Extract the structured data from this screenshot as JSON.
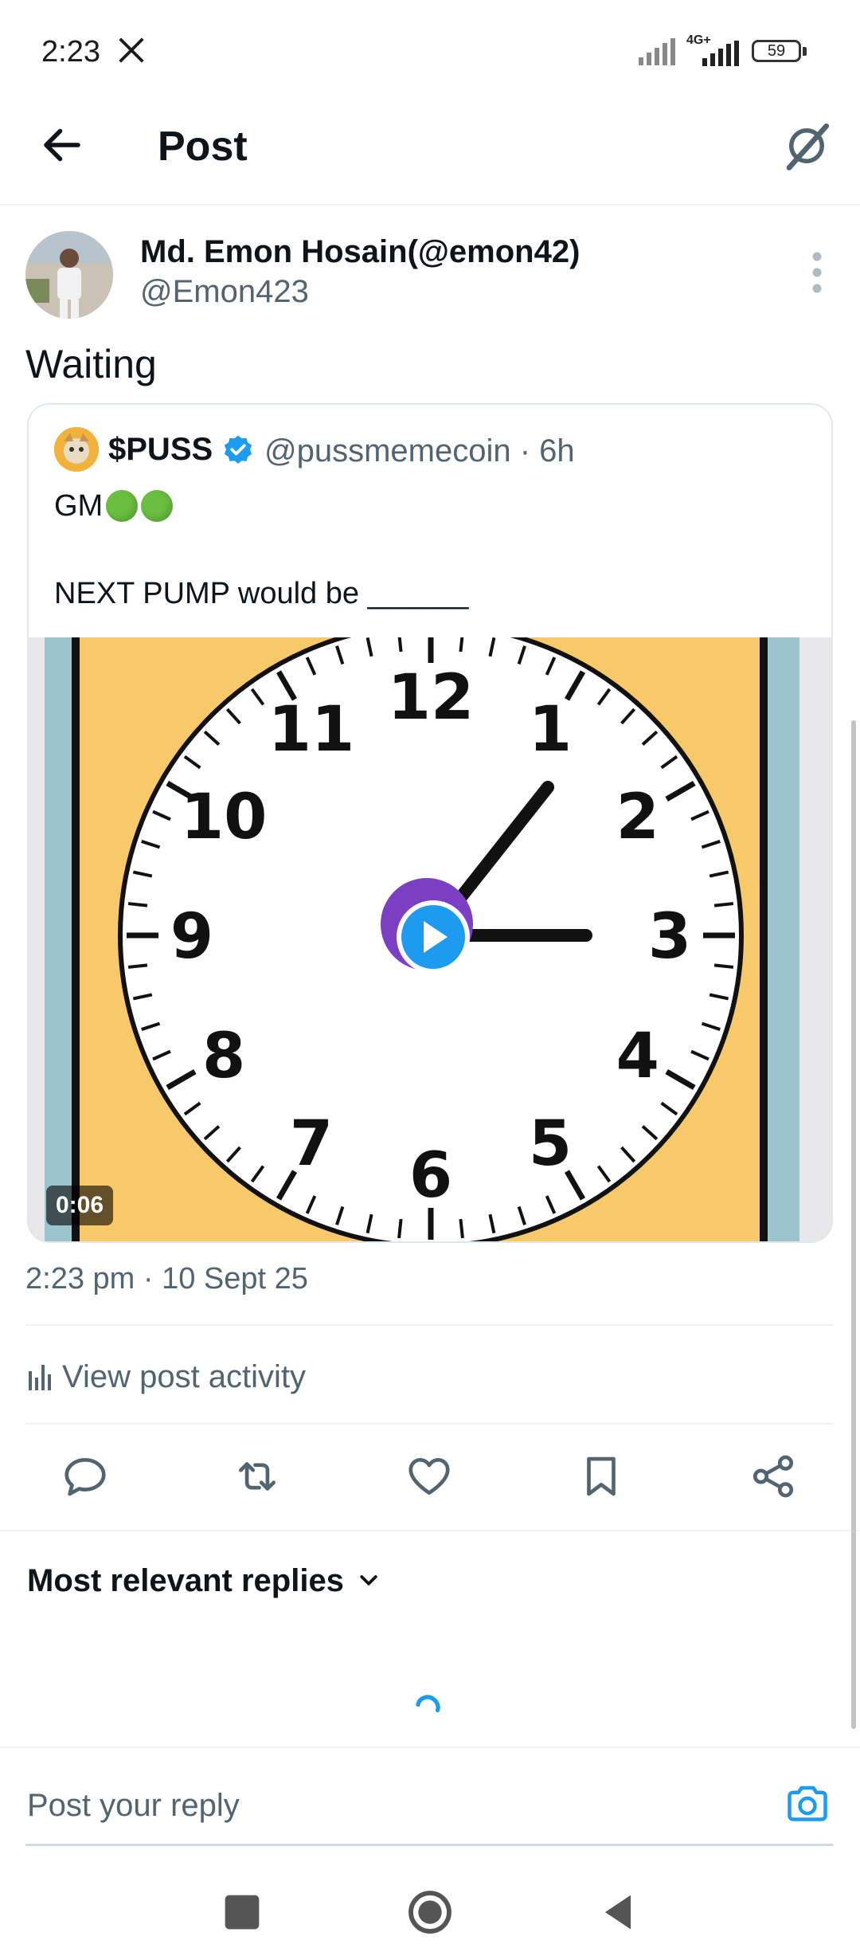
{
  "status_bar": {
    "time": "2:23",
    "network": "4G+",
    "battery": "59"
  },
  "header": {
    "title": "Post"
  },
  "post": {
    "author_name": "Md. Emon Hosain(@emon42)",
    "author_handle": "@Emon423",
    "text": "Waiting",
    "timestamp": "2:23 pm · 10 Sept 25"
  },
  "quote": {
    "name": "$PUSS",
    "meta": "@pussmemecoin · 6h",
    "line1": "GM",
    "line2": "NEXT PUMP would be ______",
    "video_duration": "0:06",
    "clock_numbers": [
      "12",
      "1",
      "2",
      "3",
      "4",
      "5",
      "6",
      "7",
      "8",
      "9",
      "10",
      "11"
    ]
  },
  "activity": {
    "label": "View post activity"
  },
  "actions": [
    "reply-icon",
    "repost-icon",
    "like-icon",
    "bookmark-icon",
    "share-icon"
  ],
  "replies": {
    "sort_label": "Most relevant replies"
  },
  "reply_box": {
    "placeholder": "Post your reply"
  },
  "colors": {
    "accent": "#1d9bf0",
    "text_secondary": "#536471",
    "divider": "#eff3f4",
    "video_bg": "#f7c96a"
  }
}
